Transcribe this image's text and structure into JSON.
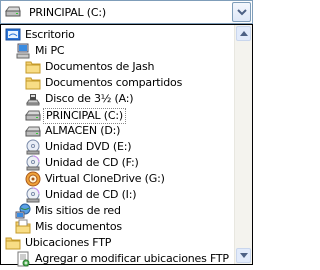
{
  "combo": {
    "value": "PRINCIPAL (C:)",
    "icon": "hard-drive-icon"
  },
  "tree": [
    {
      "label": "Escritorio",
      "icon": "desktop-icon",
      "level": 0
    },
    {
      "label": "Mi PC",
      "icon": "computer-icon",
      "level": 1
    },
    {
      "label": "Documentos de Jash",
      "icon": "folder-icon",
      "level": 2
    },
    {
      "label": "Documentos compartidos",
      "icon": "folder-icon",
      "level": 2
    },
    {
      "label": "Disco de 3½ (A:)",
      "icon": "floppy-icon",
      "level": 2
    },
    {
      "label": "PRINCIPAL (C:)",
      "icon": "hard-drive-icon",
      "level": 2,
      "selected": true
    },
    {
      "label": "ALMACEN (D:)",
      "icon": "hard-drive-icon",
      "level": 2
    },
    {
      "label": "Unidad DVD (E:)",
      "icon": "dvd-drive-icon",
      "level": 2
    },
    {
      "label": "Unidad de CD (F:)",
      "icon": "cd-drive-icon",
      "level": 2
    },
    {
      "label": "Virtual CloneDrive (G:)",
      "icon": "clonedrive-icon",
      "level": 2
    },
    {
      "label": "Unidad de CD (I:)",
      "icon": "cd-drive-icon",
      "level": 2
    },
    {
      "label": "Mis sitios de red",
      "icon": "network-places-icon",
      "level": 1
    },
    {
      "label": "Mis documentos",
      "icon": "my-documents-icon",
      "level": 1
    },
    {
      "label": "Ubicaciones FTP",
      "icon": "folder-icon",
      "level": 0
    },
    {
      "label": "Agregar o modificar ubicaciones FTP",
      "icon": "ftp-add-icon",
      "level": 1
    }
  ]
}
